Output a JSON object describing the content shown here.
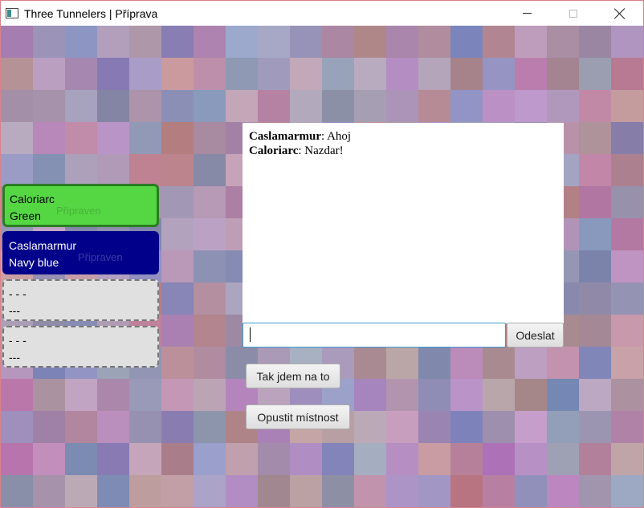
{
  "window": {
    "title": "Three Tunnelers | Příprava"
  },
  "players": [
    {
      "name": "Caloriarc",
      "color_name": "Green",
      "status": "Připraven",
      "bg": "#55d744"
    },
    {
      "name": "Caslamarmur",
      "color_name": "Navy blue",
      "status": "Připraven",
      "bg": "#00008b"
    },
    {
      "name": "- - -",
      "color_name": "---"
    },
    {
      "name": "- - -",
      "color_name": "---"
    }
  ],
  "chat": {
    "messages": [
      {
        "author": "Caslamarmur",
        "text": ": Ahoj"
      },
      {
        "author": "Caloriarc",
        "text": ": Nazdar!"
      }
    ],
    "input_value": "",
    "send_label": "Odeslat"
  },
  "actions": {
    "ready_label": "Tak jdem na to",
    "leave_label": "Opustit místnost"
  },
  "icons": {
    "app": "app-window-icon",
    "minimize": "minimize-icon",
    "maximize": "maximize-icon",
    "close": "close-icon"
  }
}
